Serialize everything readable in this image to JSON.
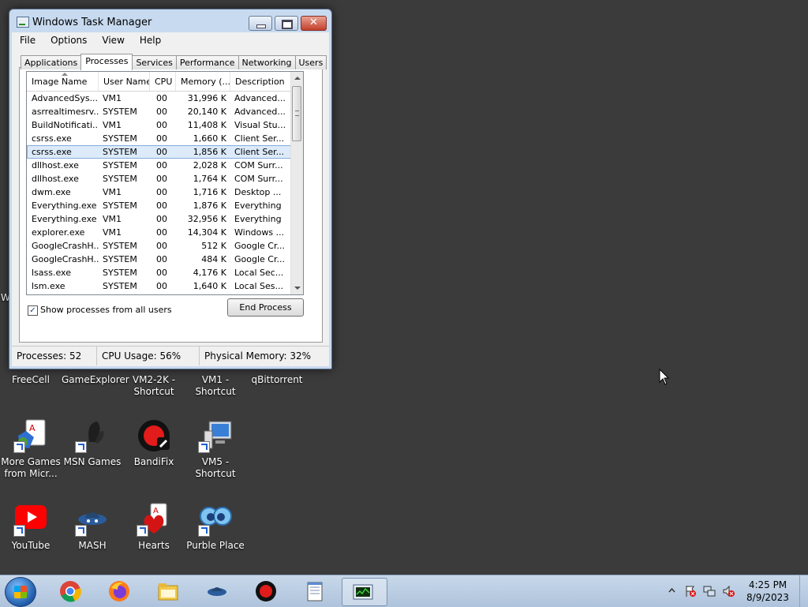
{
  "window": {
    "title": "Windows Task Manager",
    "menu": [
      "File",
      "Options",
      "View",
      "Help"
    ],
    "tabs": [
      "Applications",
      "Processes",
      "Services",
      "Performance",
      "Networking",
      "Users"
    ],
    "active_tab": "Processes",
    "columns": [
      "Image Name",
      "User Name",
      "CPU",
      "Memory (...",
      "Description"
    ],
    "rows": [
      {
        "image": "AdvancedSys...",
        "user": "VM1",
        "cpu": "00",
        "mem": "31,996 K",
        "desc": "Advanced..."
      },
      {
        "image": "asrrealtimesrv...",
        "user": "SYSTEM",
        "cpu": "00",
        "mem": "20,140 K",
        "desc": "Advanced..."
      },
      {
        "image": "BuildNotificati...",
        "user": "VM1",
        "cpu": "00",
        "mem": "11,408 K",
        "desc": "Visual Stu..."
      },
      {
        "image": "csrss.exe",
        "user": "SYSTEM",
        "cpu": "00",
        "mem": "1,660 K",
        "desc": "Client Ser..."
      },
      {
        "image": "csrss.exe",
        "user": "SYSTEM",
        "cpu": "00",
        "mem": "1,856 K",
        "desc": "Client Ser...",
        "selected": true
      },
      {
        "image": "dllhost.exe",
        "user": "SYSTEM",
        "cpu": "00",
        "mem": "2,028 K",
        "desc": "COM Surr..."
      },
      {
        "image": "dllhost.exe",
        "user": "SYSTEM",
        "cpu": "00",
        "mem": "1,764 K",
        "desc": "COM Surr..."
      },
      {
        "image": "dwm.exe",
        "user": "VM1",
        "cpu": "00",
        "mem": "1,716 K",
        "desc": "Desktop ..."
      },
      {
        "image": "Everything.exe",
        "user": "SYSTEM",
        "cpu": "00",
        "mem": "1,876 K",
        "desc": "Everything"
      },
      {
        "image": "Everything.exe",
        "user": "VM1",
        "cpu": "00",
        "mem": "32,956 K",
        "desc": "Everything"
      },
      {
        "image": "explorer.exe",
        "user": "VM1",
        "cpu": "00",
        "mem": "14,304 K",
        "desc": "Windows ..."
      },
      {
        "image": "GoogleCrashH...",
        "user": "SYSTEM",
        "cpu": "00",
        "mem": "512 K",
        "desc": "Google Cr..."
      },
      {
        "image": "GoogleCrashH...",
        "user": "SYSTEM",
        "cpu": "00",
        "mem": "484 K",
        "desc": "Google Cr..."
      },
      {
        "image": "lsass.exe",
        "user": "SYSTEM",
        "cpu": "00",
        "mem": "4,176 K",
        "desc": "Local Sec..."
      },
      {
        "image": "lsm.exe",
        "user": "SYSTEM",
        "cpu": "00",
        "mem": "1,640 K",
        "desc": "Local Ses..."
      }
    ],
    "show_all_users_label": "Show processes from all users",
    "show_all_users_checked": true,
    "check_mark": "✓",
    "end_process_label": "End Process",
    "close_glyph": "✕",
    "status": {
      "processes": "Processes: 52",
      "cpu_usage": "CPU Usage: 56%",
      "physical_memory": "Physical Memory: 32%"
    }
  },
  "desktop": {
    "clipped_label": "W",
    "icons": [
      {
        "label": "FreeCell",
        "icon": "freecell-icon",
        "label_only": true
      },
      {
        "label": "GameExplorer",
        "icon": "game-explorer-icon",
        "label_only": true
      },
      {
        "label": "VM2-2K - Shortcut",
        "icon": "vm-shortcut-icon",
        "label_only": true
      },
      {
        "label": "VM1 - Shortcut",
        "icon": "vm-shortcut-icon",
        "label_only": true
      },
      {
        "label": "qBittorrent",
        "icon": "qbittorrent-icon",
        "label_only": true
      },
      {
        "label": "More Games from Micr...",
        "icon": "more-games-icon"
      },
      {
        "label": "MSN Games",
        "icon": "msn-games-icon"
      },
      {
        "label": "BandiFix",
        "icon": "bandifix-icon"
      },
      {
        "label": "VM5 - Shortcut",
        "icon": "computer-icon"
      },
      {
        "label": "YouTube",
        "icon": "youtube-icon"
      },
      {
        "label": "MASH",
        "icon": "mash-icon"
      },
      {
        "label": "Hearts",
        "icon": "hearts-icon"
      },
      {
        "label": "Purble Place",
        "icon": "purble-place-icon"
      }
    ]
  },
  "taskbar": {
    "items": [
      "chrome-icon",
      "firefox-icon",
      "file-explorer-icon",
      "mash-icon",
      "bandicam-icon",
      "notepad-icon",
      "task-manager-icon"
    ],
    "active_item": "task-manager-icon",
    "tray_icons": [
      "show-hidden-icons-chevron",
      "action-center-flag-icon",
      "network-icon",
      "volume-muted-icon"
    ],
    "time": "4:25 PM",
    "date": "8/9/2023"
  },
  "colors": {
    "desktop": "#3b3b3b",
    "window_frame": "#c7daf0",
    "selection": "#dceaf9",
    "close_button": "#c33f2a"
  }
}
